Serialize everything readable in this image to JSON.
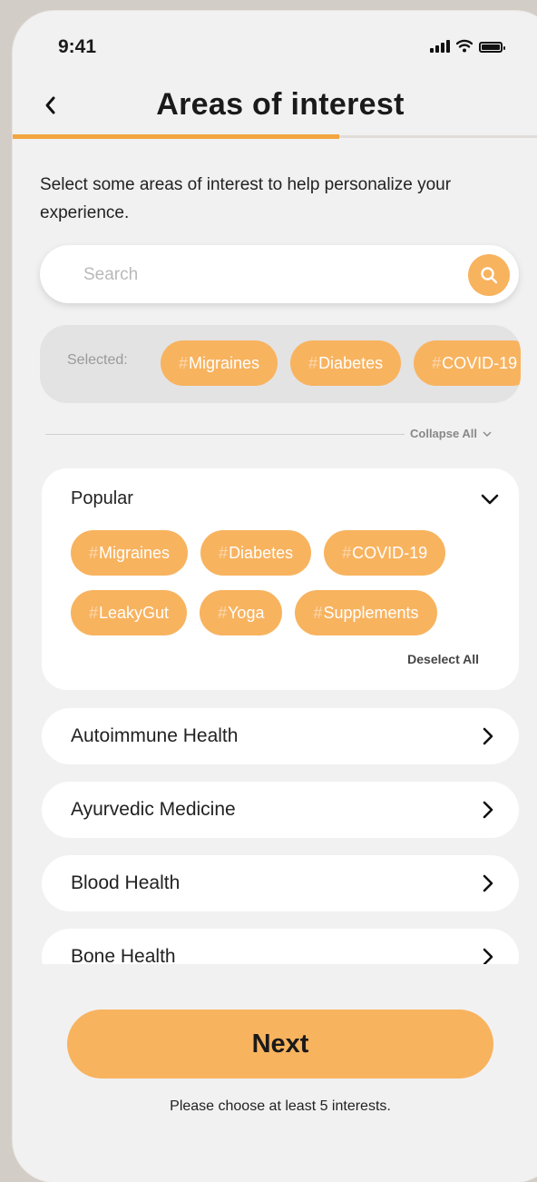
{
  "status": {
    "time": "9:41"
  },
  "header": {
    "title": "Areas of interest",
    "progress": 0.6
  },
  "intro": "Select some areas of interest to help personalize your experience.",
  "search": {
    "placeholder": "Search",
    "value": ""
  },
  "selected": {
    "label": "Selected:",
    "chips": [
      "Migraines",
      "Diabetes",
      "COVID-19"
    ]
  },
  "collapse_all": "Collapse All",
  "popular": {
    "title": "Popular",
    "row1": [
      "Migraines",
      "Diabetes",
      "COVID-19"
    ],
    "row2": [
      "LeakyGut",
      "Yoga",
      "Supplements"
    ],
    "deselect_all": "Deselect All"
  },
  "categories": [
    "Autoimmune Health",
    "Ayurvedic Medicine",
    "Blood Health",
    "Bone Health"
  ],
  "footer": {
    "next_label": "Next",
    "hint": "Please choose at least 5 interests."
  },
  "colors": {
    "accent": "#f8b35f",
    "progress": "#f3a540",
    "background": "#f1f1f1"
  },
  "icons": {
    "back": "chevron-left-icon",
    "search": "magnifier-icon",
    "collapse": "chevron-down-icon",
    "category": "chevron-right-icon"
  }
}
